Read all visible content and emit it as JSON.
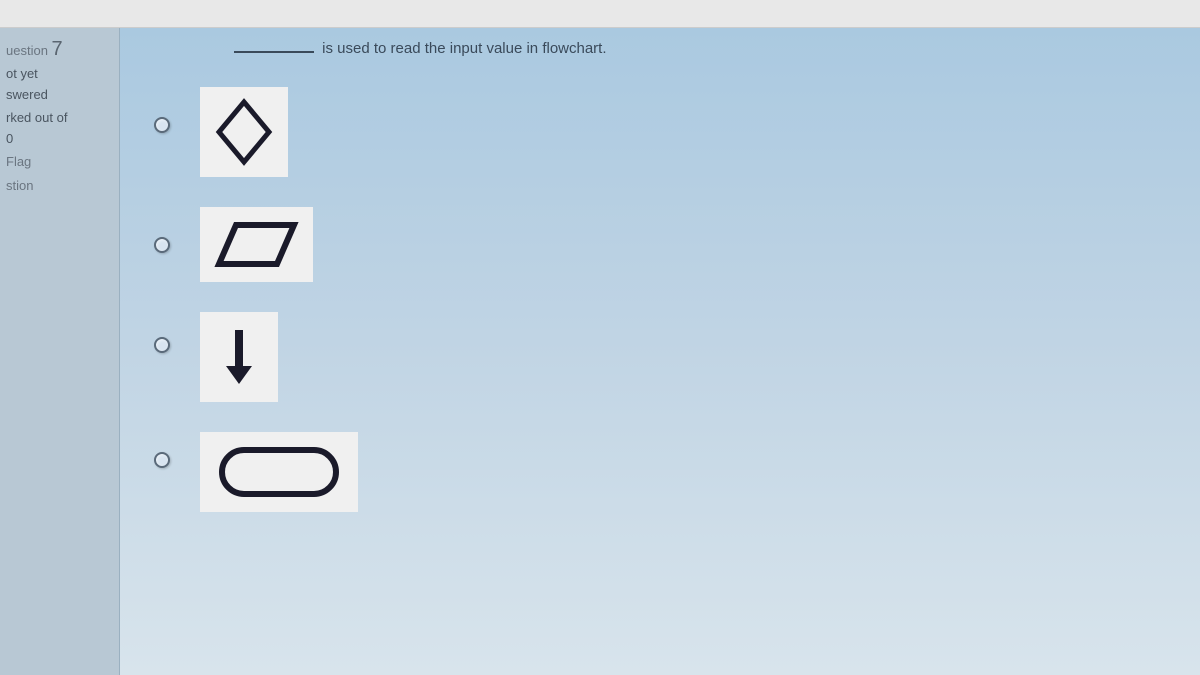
{
  "sidebar": {
    "question_label": "uestion",
    "question_number": "7",
    "status_line1": "ot yet",
    "status_line2": "swered",
    "marked_line1": "rked out of",
    "marked_line2": "0",
    "flag_line1": "Flag",
    "flag_line2": "stion"
  },
  "question": {
    "text": "is used to read the input value in flowchart."
  },
  "options": {
    "a": {
      "shape": "diamond"
    },
    "b": {
      "shape": "parallelogram"
    },
    "c": {
      "shape": "arrow-down"
    },
    "d": {
      "shape": "rounded-rectangle"
    }
  }
}
